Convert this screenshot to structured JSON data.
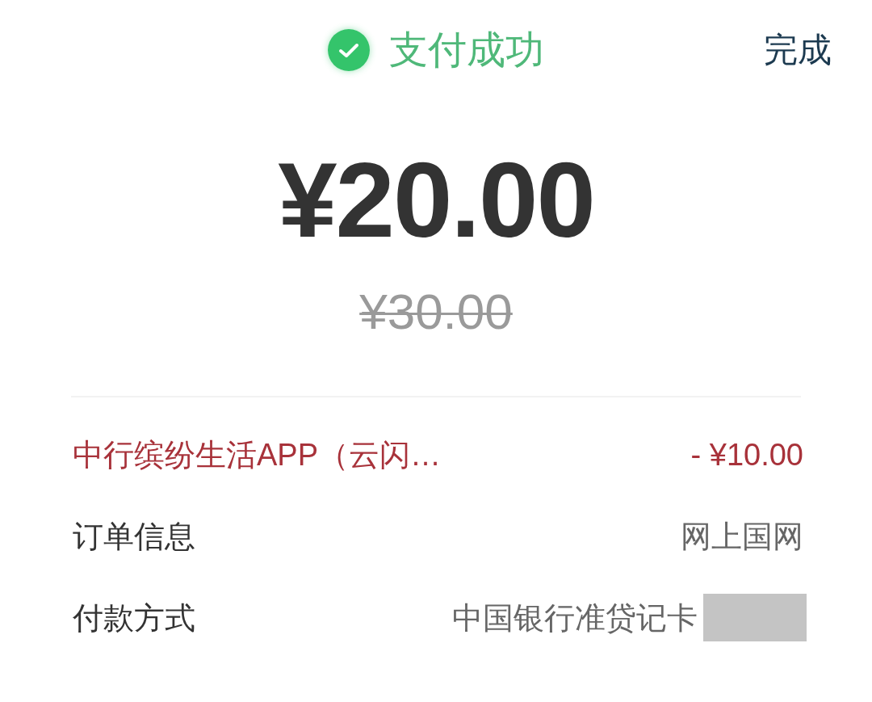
{
  "header": {
    "status": "支付成功",
    "done_button": "完成"
  },
  "amount": "¥20.00",
  "original_amount": "¥30.00",
  "rows": [
    {
      "kind": "discount",
      "label": "中行缤纷生活APP（云闪…",
      "value": "- ¥10.00",
      "redacted": false
    },
    {
      "kind": "info",
      "label": "订单信息",
      "value": "网上国网",
      "redacted": false
    },
    {
      "kind": "info",
      "label": "付款方式",
      "value": "中国银行准贷记卡",
      "redacted": true
    }
  ]
}
